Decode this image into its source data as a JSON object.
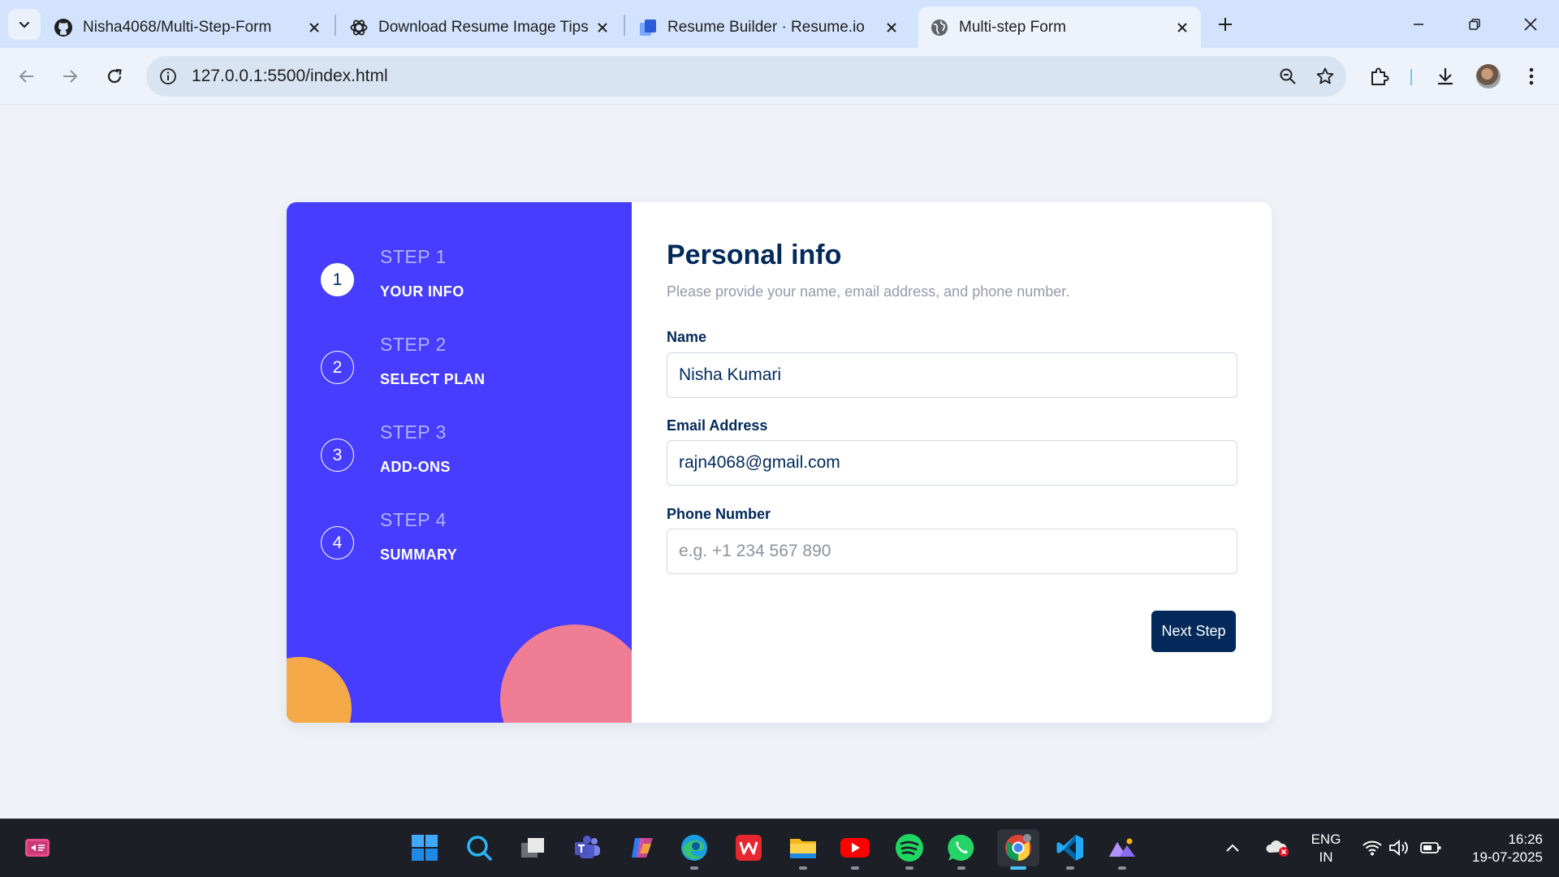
{
  "browser": {
    "tabs": [
      {
        "title": "Nisha4068/Multi-Step-Form",
        "icon": "github-icon"
      },
      {
        "title": "Download Resume Image Tips",
        "icon": "openai-icon"
      },
      {
        "title": "Resume Builder · Resume.io",
        "icon": "resumeio-icon"
      },
      {
        "title": "Multi-step Form",
        "icon": "globe-icon",
        "active": true
      }
    ],
    "url": "127.0.0.1:5500/index.html"
  },
  "sidebar": {
    "steps": [
      {
        "number": "1",
        "kicker": "STEP 1",
        "title": "YOUR INFO",
        "active": true
      },
      {
        "number": "2",
        "kicker": "STEP 2",
        "title": "SELECT PLAN",
        "active": false
      },
      {
        "number": "3",
        "kicker": "STEP 3",
        "title": "ADD-ONS",
        "active": false
      },
      {
        "number": "4",
        "kicker": "STEP 4",
        "title": "SUMMARY",
        "active": false
      }
    ]
  },
  "form": {
    "title": "Personal info",
    "subtitle": "Please provide your name, email address, and phone number.",
    "fields": {
      "name": {
        "label": "Name",
        "value": "Nisha Kumari",
        "placeholder": ""
      },
      "email": {
        "label": "Email Address",
        "value": "rajn4068@gmail.com",
        "placeholder": ""
      },
      "phone": {
        "label": "Phone Number",
        "value": "",
        "placeholder": "e.g. +1 234 567 890"
      }
    },
    "next_label": "Next Step"
  },
  "taskbar": {
    "language_line1": "ENG",
    "language_line2": "IN",
    "time": "16:26",
    "date": "19-07-2025"
  },
  "colors": {
    "sidebar_bg": "#473dff",
    "primary_dark": "#022959",
    "blob_yellow": "#ffaf3f",
    "blob_pink": "#f9818e"
  }
}
